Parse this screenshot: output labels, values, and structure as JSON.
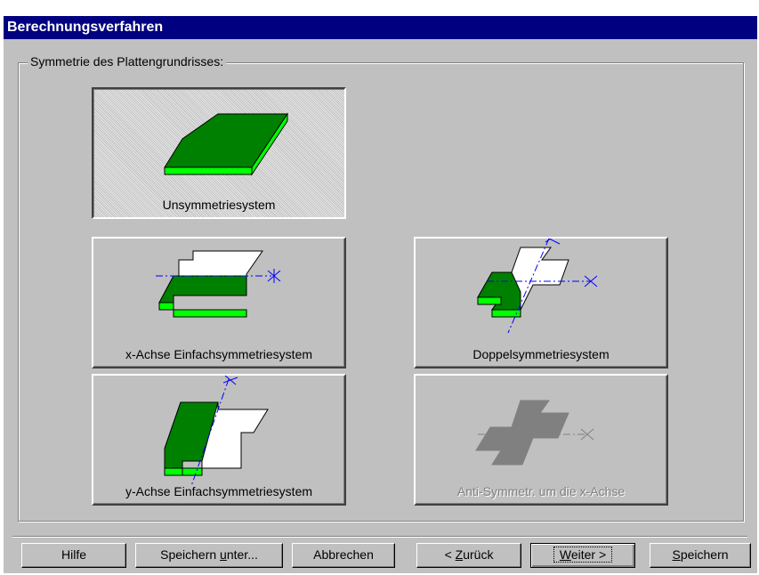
{
  "window": {
    "title": "Berechnungsverfahren"
  },
  "group": {
    "legend": "Symmetrie des Plattengrundrisses:"
  },
  "options": {
    "unsym": {
      "label": "Unsymmetriesystem",
      "selected": true
    },
    "xsym": {
      "label": "x-Achse Einfachsymmetriesystem"
    },
    "dsym": {
      "label": "Doppelsymmetriesystem"
    },
    "ysym": {
      "label": "y-Achse Einfachsymmetriesystem"
    },
    "antisym": {
      "label": "Anti-Symmetr. um die x-Achse",
      "enabled": false
    }
  },
  "buttons": {
    "help": "Hilfe",
    "save_as_pre": "Speichern ",
    "save_as_u": "u",
    "save_as_post": "nter...",
    "cancel": "Abbrechen",
    "back_pre": "< ",
    "back_u": "Z",
    "back_post": "urück",
    "next_u": "W",
    "next_post": "eiter >",
    "save_u": "S",
    "save_post": "peichern"
  },
  "colors": {
    "titlebar": "#000080",
    "face": "#c0c0c0",
    "plate_dark": "#008000",
    "plate_light": "#00ff00",
    "axis": "#0000ff",
    "disabled_plate": "#808080"
  }
}
